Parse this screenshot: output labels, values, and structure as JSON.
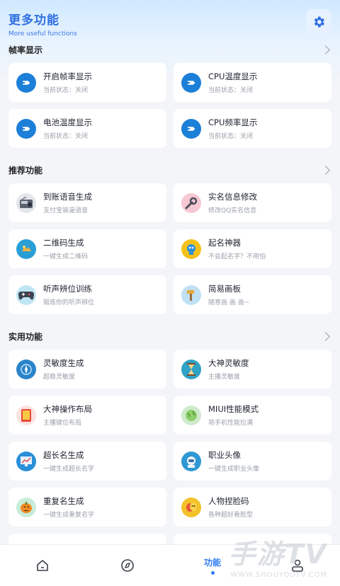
{
  "header": {
    "title": "更多功能",
    "subtitle": "More useful functions"
  },
  "sections": {
    "fps": {
      "label": "帧率显示"
    },
    "recommend": {
      "label": "推荐功能"
    },
    "practical": {
      "label": "实用功能"
    }
  },
  "cards": {
    "fps_toggle": {
      "title": "开启帧率显示",
      "sub": "当前状态：关闭"
    },
    "cpu_temp": {
      "title": "CPU温度显示",
      "sub": "当前状态：关闭"
    },
    "battery_temp": {
      "title": "电池温度显示",
      "sub": "当前状态：关闭"
    },
    "cpu_freq": {
      "title": "CPU频率显示",
      "sub": "当前状态：关闭"
    },
    "voice_gen": {
      "title": "到账语音生成",
      "sub": "支付宝装逼语音"
    },
    "realname": {
      "title": "实名信息修改",
      "sub": "修改QQ实名信息"
    },
    "qrcode": {
      "title": "二维码生成",
      "sub": "一键生成二维码"
    },
    "naming": {
      "title": "起名神器",
      "sub": "不会起名字？不用怕"
    },
    "sound_train": {
      "title": "听声辨位训练",
      "sub": "锻炼你的听声辨位"
    },
    "drawing": {
      "title": "简易画板",
      "sub": "随意画 画 画~"
    },
    "sensitivity": {
      "title": "灵敏度生成",
      "sub": "超稳灵敏度"
    },
    "master_sens": {
      "title": "大神灵敏度",
      "sub": "主播灵敏度"
    },
    "layout": {
      "title": "大神操作布局",
      "sub": "主播键位布局"
    },
    "miui": {
      "title": "MIUI性能模式",
      "sub": "将手机性能拉满"
    },
    "longname": {
      "title": "超长名生成",
      "sub": "一键生成超长名字"
    },
    "avatar": {
      "title": "职业头像",
      "sub": "一键生成职业头像"
    },
    "dupname": {
      "title": "重复名生成",
      "sub": "一键生成重复名字"
    },
    "facecode": {
      "title": "人物捏脸码",
      "sub": "各种超好看脸型"
    }
  },
  "tabbar": {
    "active_label": "功能"
  },
  "watermark": {
    "big": "手游TV",
    "small": "WWW.SHOUYOUTV.COM"
  },
  "colors": {
    "accent": "#2f7bf0",
    "dash_icon": "#1c7fd8"
  }
}
